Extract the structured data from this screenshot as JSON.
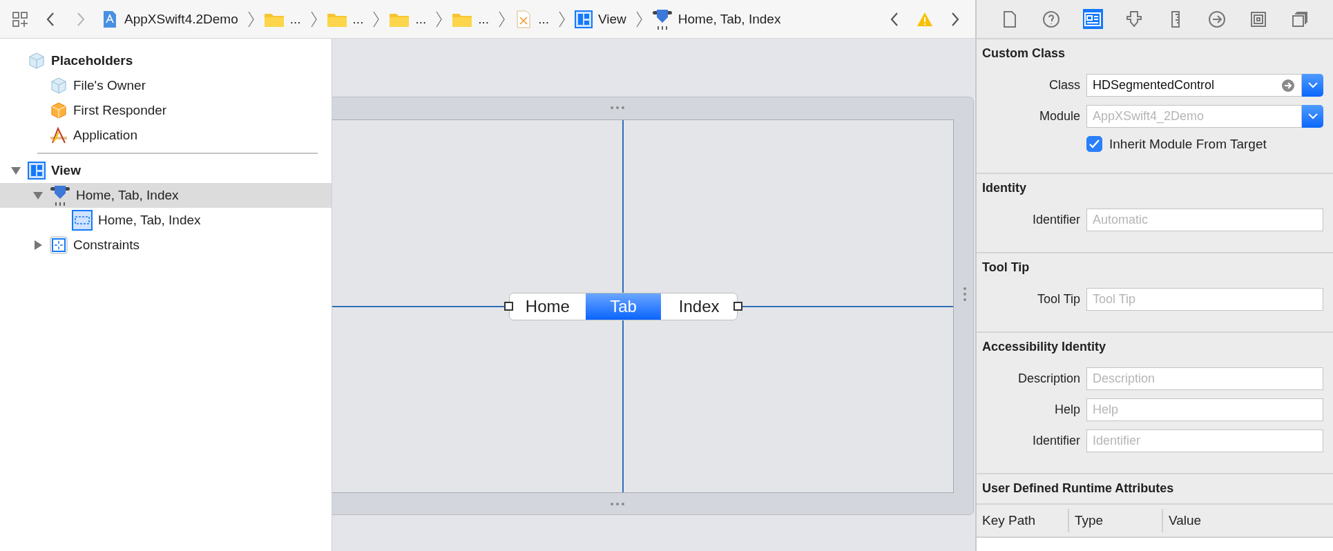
{
  "toolbar": {
    "nav": [
      {
        "kind": "back",
        "disabled": false
      },
      {
        "kind": "forward",
        "disabled": true
      }
    ],
    "breadcrumbs": [
      {
        "kind": "project",
        "label": "AppXSwift4.2Demo"
      },
      {
        "kind": "folder",
        "label": "..."
      },
      {
        "kind": "folder",
        "label": "..."
      },
      {
        "kind": "folder",
        "label": "..."
      },
      {
        "kind": "folder",
        "label": "..."
      },
      {
        "kind": "xib",
        "label": "..."
      },
      {
        "kind": "view",
        "label": "View"
      },
      {
        "kind": "segmented",
        "label": "Home, Tab, Index"
      }
    ],
    "issue_nav": [
      {
        "kind": "back",
        "disabled": false
      },
      {
        "kind": "warning",
        "disabled": false
      },
      {
        "kind": "forward",
        "disabled": false
      }
    ]
  },
  "outline": [
    {
      "kind": "cube",
      "label": "Placeholders",
      "selected": false,
      "children": [
        {
          "kind": "cube",
          "label": "File's Owner",
          "selected": false
        },
        {
          "kind": "responder",
          "label": "First Responder",
          "selected": false
        },
        {
          "kind": "application",
          "label": "Application",
          "selected": false
        }
      ]
    },
    {
      "kind": "view",
      "label": "View",
      "selected": false,
      "expanded": true,
      "children": [
        {
          "kind": "segmented",
          "label": "Home, Tab, Index",
          "selected": true,
          "expanded": true,
          "children": [
            {
              "kind": "segments",
              "label": "Home, Tab, Index",
              "selected": false
            }
          ]
        },
        {
          "kind": "constraints",
          "label": "Constraints",
          "selected": false,
          "expanded": false
        }
      ]
    }
  ],
  "canvas": {
    "segmented_control": {
      "segments": [
        {
          "label": "Home",
          "selected": false
        },
        {
          "label": "Tab",
          "selected": true
        },
        {
          "label": "Index",
          "selected": false
        }
      ]
    }
  },
  "inspector": {
    "tabs": [
      {
        "kind": "file",
        "selected": false
      },
      {
        "kind": "help",
        "selected": false
      },
      {
        "kind": "identity",
        "selected": true
      },
      {
        "kind": "attributes",
        "selected": false
      },
      {
        "kind": "size",
        "selected": false
      },
      {
        "kind": "connections",
        "selected": false
      },
      {
        "kind": "bindings",
        "selected": false
      },
      {
        "kind": "effects",
        "selected": false
      }
    ],
    "sections": [
      {
        "title": "Custom Class",
        "rows": [
          {
            "kind": "combo",
            "label": "Class",
            "value": "HDSegmentedControl"
          },
          {
            "kind": "dropdown",
            "label": "Module",
            "placeholder": "AppXSwift4_2Demo"
          },
          {
            "kind": "checkbox",
            "label": "Inherit Module From Target",
            "checked": true
          }
        ]
      },
      {
        "title": "Identity",
        "rows": [
          {
            "kind": "text",
            "label": "Identifier",
            "placeholder": "Automatic"
          }
        ]
      },
      {
        "title": "Tool Tip",
        "rows": [
          {
            "kind": "text",
            "label": "Tool Tip",
            "placeholder": "Tool Tip"
          }
        ]
      },
      {
        "title": "Accessibility Identity",
        "rows": [
          {
            "kind": "text",
            "label": "Description",
            "placeholder": "Description"
          },
          {
            "kind": "text",
            "label": "Help",
            "placeholder": "Help"
          },
          {
            "kind": "text",
            "label": "Identifier",
            "placeholder": "Identifier"
          }
        ]
      },
      {
        "title": "User Defined Runtime Attributes",
        "table": {
          "columns": [
            "Key Path",
            "Type",
            "Value"
          ]
        }
      }
    ]
  }
}
